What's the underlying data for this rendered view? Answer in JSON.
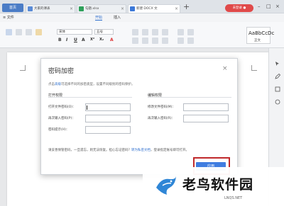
{
  "tabs": {
    "home": "首页",
    "items": [
      {
        "label": "大家的课表",
        "color": "#5a8bd6"
      },
      {
        "label": "勾题.xlsx",
        "color": "#2ea05a"
      },
      {
        "label": "新建 DOCX 文",
        "color": "#3b78d8"
      }
    ],
    "add": "+",
    "login": "未登录 ●"
  },
  "menu": [
    "≡ 文件",
    "开始",
    "插入"
  ],
  "ribbon": {
    "font_value": "宋体",
    "size_value": "五号",
    "format_glyphs": [
      "B",
      "I",
      "U",
      "A",
      "X²",
      "X₂",
      "A"
    ],
    "style_sample": "AaBbCcDc",
    "style_name": "正文"
  },
  "dialog": {
    "title": "密码加密",
    "close_glyph": "×",
    "hint_prefix": "点击",
    "hint_link": "高级",
    "hint_suffix": "可选择不同的加密类型，设置不同级别的密码保护。",
    "open_group": {
      "title": "打开权限",
      "fields": [
        {
          "label": "打开文件密码(O)：",
          "value": ""
        },
        {
          "label": "再次输入密码(P)：",
          "value": ""
        },
        {
          "label": "密码提示(H)：",
          "value": ""
        }
      ]
    },
    "edit_group": {
      "title": "编辑权限",
      "fields": [
        {
          "label": "修改文件密码(M)：",
          "value": ""
        },
        {
          "label": "再次输入密码(R)：",
          "value": ""
        }
      ]
    },
    "warning_prefix": "请妥善保管密码，一旦遗忘，则无法恢复。担心忘记密码？",
    "warning_link": "转为私密文档",
    "warning_suffix": "，登录指定账号即可打开。",
    "apply_label": "应用"
  },
  "watermark": {
    "title": "老鸟软件园",
    "url": "LNQS.NET"
  }
}
